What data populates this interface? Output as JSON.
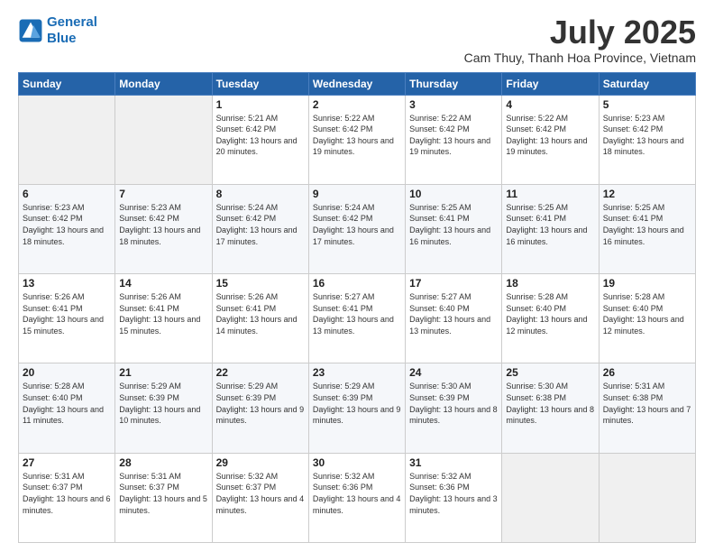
{
  "logo": {
    "line1": "General",
    "line2": "Blue"
  },
  "title": "July 2025",
  "subtitle": "Cam Thuy, Thanh Hoa Province, Vietnam",
  "days_of_week": [
    "Sunday",
    "Monday",
    "Tuesday",
    "Wednesday",
    "Thursday",
    "Friday",
    "Saturday"
  ],
  "weeks": [
    [
      {
        "day": "",
        "sunrise": "",
        "sunset": "",
        "daylight": ""
      },
      {
        "day": "",
        "sunrise": "",
        "sunset": "",
        "daylight": ""
      },
      {
        "day": "1",
        "sunrise": "Sunrise: 5:21 AM",
        "sunset": "Sunset: 6:42 PM",
        "daylight": "Daylight: 13 hours and 20 minutes."
      },
      {
        "day": "2",
        "sunrise": "Sunrise: 5:22 AM",
        "sunset": "Sunset: 6:42 PM",
        "daylight": "Daylight: 13 hours and 19 minutes."
      },
      {
        "day": "3",
        "sunrise": "Sunrise: 5:22 AM",
        "sunset": "Sunset: 6:42 PM",
        "daylight": "Daylight: 13 hours and 19 minutes."
      },
      {
        "day": "4",
        "sunrise": "Sunrise: 5:22 AM",
        "sunset": "Sunset: 6:42 PM",
        "daylight": "Daylight: 13 hours and 19 minutes."
      },
      {
        "day": "5",
        "sunrise": "Sunrise: 5:23 AM",
        "sunset": "Sunset: 6:42 PM",
        "daylight": "Daylight: 13 hours and 18 minutes."
      }
    ],
    [
      {
        "day": "6",
        "sunrise": "Sunrise: 5:23 AM",
        "sunset": "Sunset: 6:42 PM",
        "daylight": "Daylight: 13 hours and 18 minutes."
      },
      {
        "day": "7",
        "sunrise": "Sunrise: 5:23 AM",
        "sunset": "Sunset: 6:42 PM",
        "daylight": "Daylight: 13 hours and 18 minutes."
      },
      {
        "day": "8",
        "sunrise": "Sunrise: 5:24 AM",
        "sunset": "Sunset: 6:42 PM",
        "daylight": "Daylight: 13 hours and 17 minutes."
      },
      {
        "day": "9",
        "sunrise": "Sunrise: 5:24 AM",
        "sunset": "Sunset: 6:42 PM",
        "daylight": "Daylight: 13 hours and 17 minutes."
      },
      {
        "day": "10",
        "sunrise": "Sunrise: 5:25 AM",
        "sunset": "Sunset: 6:41 PM",
        "daylight": "Daylight: 13 hours and 16 minutes."
      },
      {
        "day": "11",
        "sunrise": "Sunrise: 5:25 AM",
        "sunset": "Sunset: 6:41 PM",
        "daylight": "Daylight: 13 hours and 16 minutes."
      },
      {
        "day": "12",
        "sunrise": "Sunrise: 5:25 AM",
        "sunset": "Sunset: 6:41 PM",
        "daylight": "Daylight: 13 hours and 16 minutes."
      }
    ],
    [
      {
        "day": "13",
        "sunrise": "Sunrise: 5:26 AM",
        "sunset": "Sunset: 6:41 PM",
        "daylight": "Daylight: 13 hours and 15 minutes."
      },
      {
        "day": "14",
        "sunrise": "Sunrise: 5:26 AM",
        "sunset": "Sunset: 6:41 PM",
        "daylight": "Daylight: 13 hours and 15 minutes."
      },
      {
        "day": "15",
        "sunrise": "Sunrise: 5:26 AM",
        "sunset": "Sunset: 6:41 PM",
        "daylight": "Daylight: 13 hours and 14 minutes."
      },
      {
        "day": "16",
        "sunrise": "Sunrise: 5:27 AM",
        "sunset": "Sunset: 6:41 PM",
        "daylight": "Daylight: 13 hours and 13 minutes."
      },
      {
        "day": "17",
        "sunrise": "Sunrise: 5:27 AM",
        "sunset": "Sunset: 6:40 PM",
        "daylight": "Daylight: 13 hours and 13 minutes."
      },
      {
        "day": "18",
        "sunrise": "Sunrise: 5:28 AM",
        "sunset": "Sunset: 6:40 PM",
        "daylight": "Daylight: 13 hours and 12 minutes."
      },
      {
        "day": "19",
        "sunrise": "Sunrise: 5:28 AM",
        "sunset": "Sunset: 6:40 PM",
        "daylight": "Daylight: 13 hours and 12 minutes."
      }
    ],
    [
      {
        "day": "20",
        "sunrise": "Sunrise: 5:28 AM",
        "sunset": "Sunset: 6:40 PM",
        "daylight": "Daylight: 13 hours and 11 minutes."
      },
      {
        "day": "21",
        "sunrise": "Sunrise: 5:29 AM",
        "sunset": "Sunset: 6:39 PM",
        "daylight": "Daylight: 13 hours and 10 minutes."
      },
      {
        "day": "22",
        "sunrise": "Sunrise: 5:29 AM",
        "sunset": "Sunset: 6:39 PM",
        "daylight": "Daylight: 13 hours and 9 minutes."
      },
      {
        "day": "23",
        "sunrise": "Sunrise: 5:29 AM",
        "sunset": "Sunset: 6:39 PM",
        "daylight": "Daylight: 13 hours and 9 minutes."
      },
      {
        "day": "24",
        "sunrise": "Sunrise: 5:30 AM",
        "sunset": "Sunset: 6:39 PM",
        "daylight": "Daylight: 13 hours and 8 minutes."
      },
      {
        "day": "25",
        "sunrise": "Sunrise: 5:30 AM",
        "sunset": "Sunset: 6:38 PM",
        "daylight": "Daylight: 13 hours and 8 minutes."
      },
      {
        "day": "26",
        "sunrise": "Sunrise: 5:31 AM",
        "sunset": "Sunset: 6:38 PM",
        "daylight": "Daylight: 13 hours and 7 minutes."
      }
    ],
    [
      {
        "day": "27",
        "sunrise": "Sunrise: 5:31 AM",
        "sunset": "Sunset: 6:37 PM",
        "daylight": "Daylight: 13 hours and 6 minutes."
      },
      {
        "day": "28",
        "sunrise": "Sunrise: 5:31 AM",
        "sunset": "Sunset: 6:37 PM",
        "daylight": "Daylight: 13 hours and 5 minutes."
      },
      {
        "day": "29",
        "sunrise": "Sunrise: 5:32 AM",
        "sunset": "Sunset: 6:37 PM",
        "daylight": "Daylight: 13 hours and 4 minutes."
      },
      {
        "day": "30",
        "sunrise": "Sunrise: 5:32 AM",
        "sunset": "Sunset: 6:36 PM",
        "daylight": "Daylight: 13 hours and 4 minutes."
      },
      {
        "day": "31",
        "sunrise": "Sunrise: 5:32 AM",
        "sunset": "Sunset: 6:36 PM",
        "daylight": "Daylight: 13 hours and 3 minutes."
      },
      {
        "day": "",
        "sunrise": "",
        "sunset": "",
        "daylight": ""
      },
      {
        "day": "",
        "sunrise": "",
        "sunset": "",
        "daylight": ""
      }
    ]
  ]
}
